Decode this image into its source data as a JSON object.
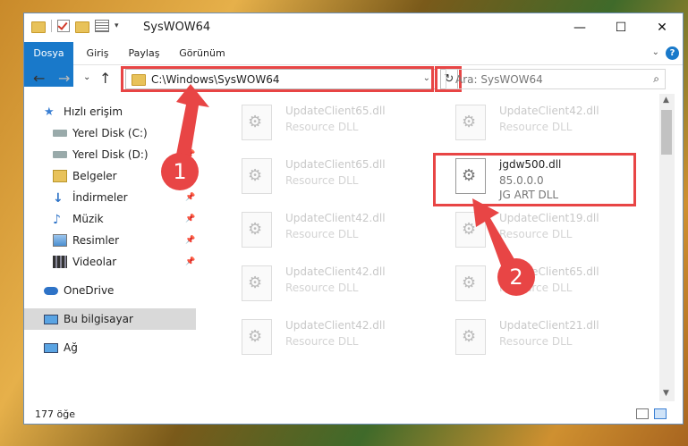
{
  "window": {
    "title": "SysWOW64",
    "buttons": {
      "minimize": "—",
      "maximize": "☐",
      "close": "✕"
    }
  },
  "ribbon": {
    "tabs": [
      "Dosya",
      "Giriş",
      "Paylaş",
      "Görünüm"
    ],
    "help": "?"
  },
  "navigation": {
    "back": "←",
    "forward": "→",
    "recent": "⌄",
    "up": "↑",
    "address": "C:\\Windows\\SysWOW64",
    "address_dropdown": "⌄",
    "refresh": "↻",
    "search_placeholder": "Ara: SysWOW64",
    "search_icon": "⌕"
  },
  "sidebar": {
    "items": [
      {
        "label": "Hızlı erişim",
        "icon": "star-icon"
      },
      {
        "label": "Yerel Disk (C:)",
        "icon": "drive-icon"
      },
      {
        "label": "Yerel Disk (D:)",
        "icon": "drive-icon"
      },
      {
        "label": "Belgeler",
        "icon": "documents-icon"
      },
      {
        "label": "İndirmeler",
        "icon": "download-icon"
      },
      {
        "label": "Müzik",
        "icon": "music-icon"
      },
      {
        "label": "Resimler",
        "icon": "pictures-icon"
      },
      {
        "label": "Videolar",
        "icon": "videos-icon"
      },
      {
        "label": "OneDrive",
        "icon": "cloud-icon"
      },
      {
        "label": "Bu bilgisayar",
        "icon": "computer-icon"
      },
      {
        "label": "Ağ",
        "icon": "network-icon"
      }
    ]
  },
  "files": [
    {
      "name": "UpdateClient65.dll",
      "desc": "Resource DLL"
    },
    {
      "name": "UpdateClient42.dll",
      "desc": "Resource DLL"
    },
    {
      "name": "UpdateClient65.dll",
      "desc": "Resource DLL"
    },
    {
      "name": "jgdw500.dll",
      "desc": "85.0.0.0",
      "desc2": "JG ART DLL"
    },
    {
      "name": "UpdateClient42.dll",
      "desc": "Resource DLL"
    },
    {
      "name": "UpdateClient19.dll",
      "desc": "Resource DLL"
    },
    {
      "name": "UpdateClient42.dll",
      "desc": "Resource DLL"
    },
    {
      "name": "UpdateClient65.dll",
      "desc": "Resource DLL"
    },
    {
      "name": "UpdateClient42.dll",
      "desc": "Resource DLL"
    },
    {
      "name": "UpdateClient21.dll",
      "desc": "Resource DLL"
    }
  ],
  "status": {
    "count": "177 öğe"
  },
  "annotations": {
    "badge1": "1",
    "badge2": "2",
    "color": "#e84545"
  }
}
